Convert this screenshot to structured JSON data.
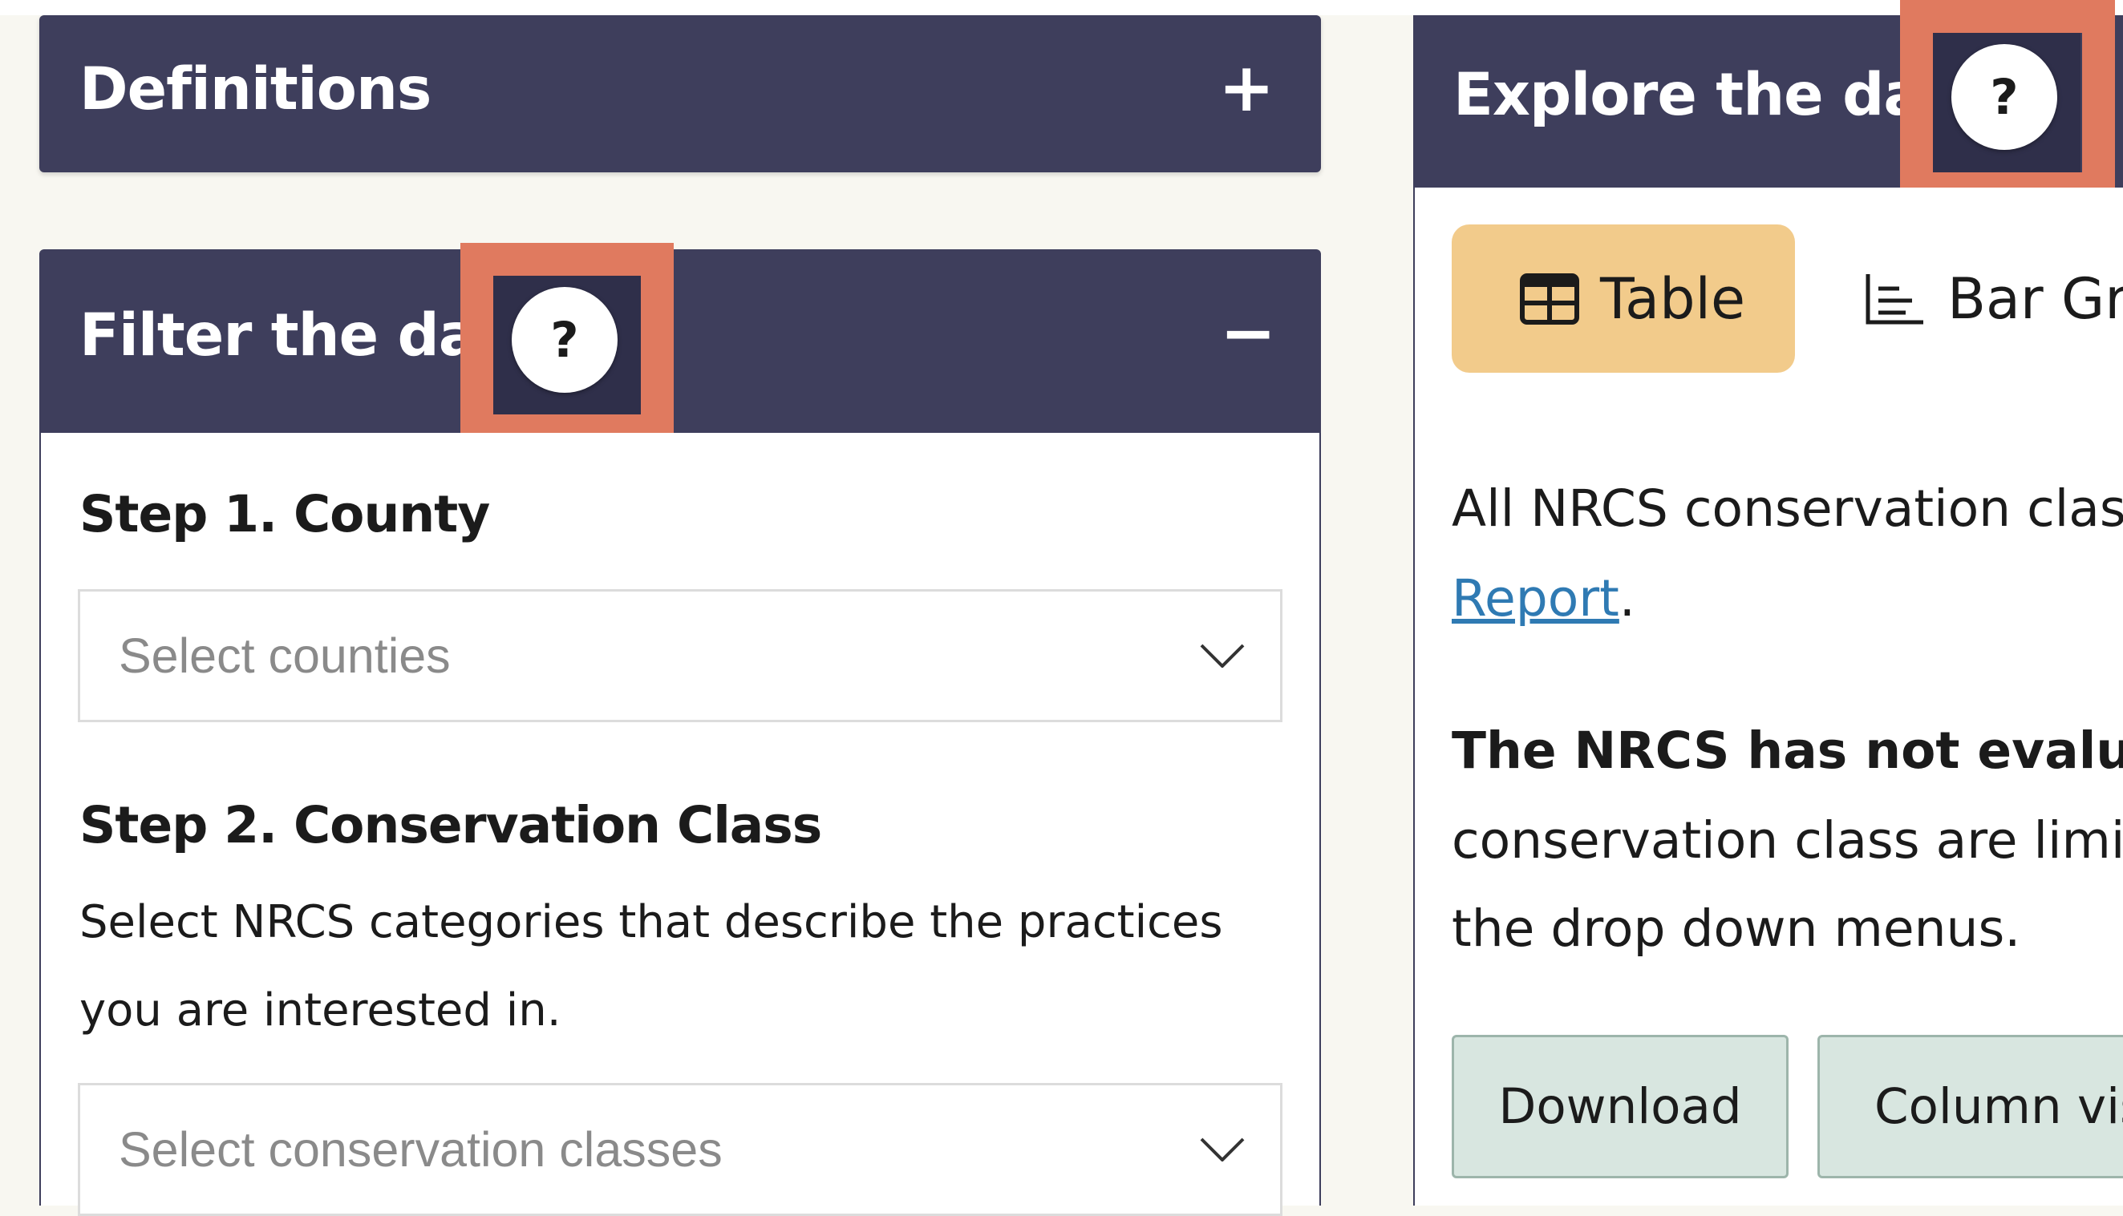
{
  "definitions": {
    "title": "Definitions",
    "toggle": "+"
  },
  "filter": {
    "title": "Filter the data",
    "toggle": "−",
    "help": "?",
    "step1": {
      "title": "Step 1. County",
      "placeholder": "Select counties"
    },
    "step2": {
      "title": "Step 2. Conservation Class",
      "description": "Select NRCS categories that describe the practices you are interested in.",
      "placeholder": "Select conservation classes"
    }
  },
  "explore": {
    "title": "Explore the data",
    "help": "?",
    "tabs": [
      {
        "label": "Table",
        "icon": "table-icon",
        "active": true
      },
      {
        "label": "Bar Graph",
        "icon": "bar-chart-icon",
        "active": false
      }
    ],
    "intro_text": "All NRCS conservation class",
    "intro_link": "Report",
    "intro_end": ".",
    "note_bold": "The NRCS has not evaluat",
    "note_line2": "conservation class are limit",
    "note_line3": "the drop down menus.",
    "buttons": {
      "download": "Download",
      "column_visibility": "Column visibility"
    }
  },
  "colors": {
    "header_bg": "#3e3e5c",
    "page_bg": "#f8f7f1",
    "highlight": "#e07a5f",
    "active_tab": "#f2cb8b",
    "button_bg": "#d8e6e0",
    "link": "#2f7ab3"
  }
}
